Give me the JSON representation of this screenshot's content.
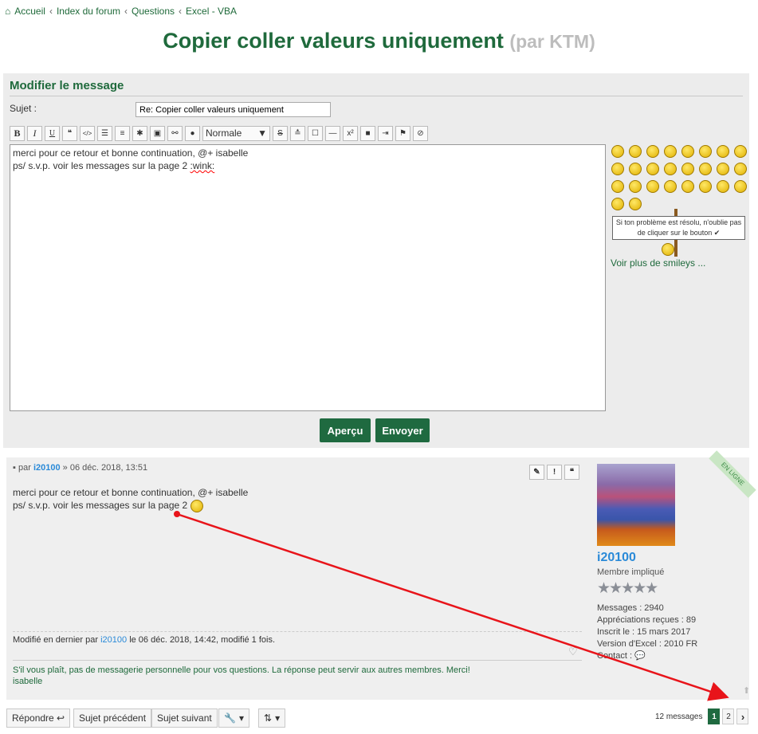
{
  "breadcrumb": [
    "Accueil",
    "Index du forum",
    "Questions",
    "Excel - VBA"
  ],
  "title": "Copier coller valeurs uniquement",
  "title_by": "(par KTM)",
  "editor": {
    "heading": "Modifier le message",
    "subject_label": "Sujet :",
    "subject_value": "Re: Copier coller valeurs uniquement",
    "toolbar": [
      "B",
      "I",
      "U",
      "❝",
      "</>",
      "☰",
      "≡",
      "✱",
      "▣",
      "⚯",
      "●",
      "S",
      "≛",
      "☐",
      "—",
      "x²",
      "■",
      "⇥",
      "⚑",
      "⊘"
    ],
    "size_select": "Normale",
    "text_line1": "merci pour ce retour et bonne continuation, @+ isabelle",
    "text_line2_a": "ps/ s.v.p. voir les messages sur la page 2 ",
    "text_line2_b": ":wink:",
    "tip": "Si ton problème est résolu, n'oublie pas de cliquer sur le bouton ✔",
    "more_smileys": "Voir plus de smileys ...",
    "preview": "Aperçu",
    "submit": "Envoyer"
  },
  "post": {
    "by": "par",
    "author": "i20100",
    "date": "» 06 déc. 2018, 13:51",
    "line1": "merci pour ce retour et bonne continuation, @+ isabelle",
    "line2": "ps/ s.v.p. voir les messages sur la page 2",
    "modified_a": "Modifié en dernier par",
    "modified_author": "i20100",
    "modified_b": "le 06 déc. 2018, 14:42, modifié 1 fois.",
    "signature1": "S'il vous plaît, pas de messagerie personnelle pour vos questions. La réponse peut servir aux autres membres. Merci!",
    "signature2": "isabelle",
    "online": "EN LIGNE",
    "rank": "Membre impliqué",
    "stars": "★★★★★",
    "stats": [
      "Messages : 2940",
      "Appréciations reçues : 89",
      "Inscrit le : 15 mars 2017",
      "Version d'Excel : 2010 FR",
      "Contact : 💬"
    ]
  },
  "bottom": {
    "reply": "Répondre ↩",
    "prev": "Sujet précédent",
    "next": "Sujet suivant",
    "count": "12 messages",
    "pages": [
      "1",
      "2"
    ],
    "next_page": "›"
  },
  "colors": {
    "green": "#1f6a3c",
    "link": "#2a8ad8",
    "arrow": "#e8141a"
  }
}
